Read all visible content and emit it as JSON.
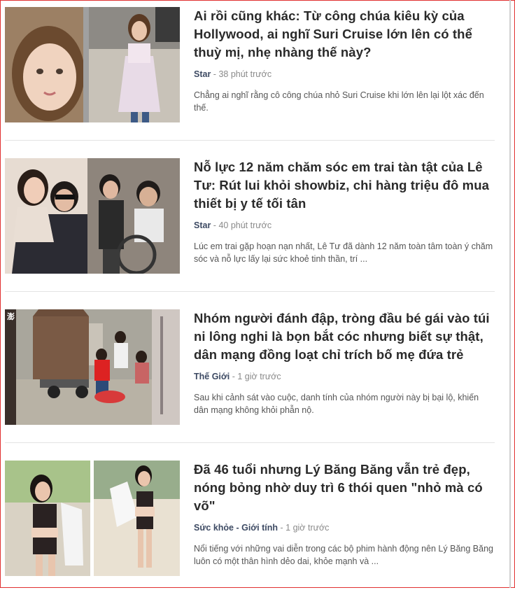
{
  "articles": [
    {
      "title": "Ai rồi cũng khác: Từ công chúa kiêu kỳ của Hollywood, ai nghĩ Suri Cruise lớn lên có thể thuỳ mị, nhẹ nhàng thế này?",
      "category": "Star",
      "separator": " - ",
      "time": "38 phút trước",
      "summary": "Chẳng ai nghĩ rằng cô công chúa nhỏ Suri Cruise khi lớn lên lại lột xác đến thế."
    },
    {
      "title": "Nỗ lực 12 năm chăm sóc em trai tàn tật của Lê Tư: Rút lui khỏi showbiz, chi hàng triệu đô mua thiết bị y tế tối tân",
      "category": "Star",
      "separator": " - ",
      "time": "40 phút trước",
      "summary": "Lúc em trai gặp hoạn nạn nhất, Lê Tư đã dành 12 năm toàn tâm toàn ý chăm sóc và nỗ lực lấy lại sức khoẻ tinh thần, trí ..."
    },
    {
      "title": "Nhóm người đánh đập, tròng đầu bé gái vào túi ni lông nghi là bọn bắt cóc nhưng biết sự thật, dân mạng đồng loạt chỉ trích bố mẹ đứa trẻ",
      "category": "Thế Giới",
      "separator": " - ",
      "time": "1 giờ trước",
      "summary": "Sau khi cảnh sát vào cuộc, danh tính của nhóm người này bị bại lộ, khiến dân mạng không khỏi phẫn nộ."
    },
    {
      "title": "Đã 46 tuổi nhưng Lý Băng Băng vẫn trẻ đẹp, nóng bỏng nhờ duy trì 6 thói quen \"nhỏ mà có võ\"",
      "category": "Sức khỏe - Giới tính",
      "separator": " - ",
      "time": "1 giờ trước",
      "summary": "Nổi tiếng với những vai diễn trong các bộ phim hành động nên Lý Băng Băng luôn có một thân hình dẻo dai, khỏe mạnh và ..."
    }
  ],
  "colors": {
    "title": "#2a2a2a",
    "category": "#3d4a63",
    "meta": "#8a8a8a",
    "summary": "#555555",
    "divider": "#e4e4e4",
    "frame": "#e03030"
  }
}
